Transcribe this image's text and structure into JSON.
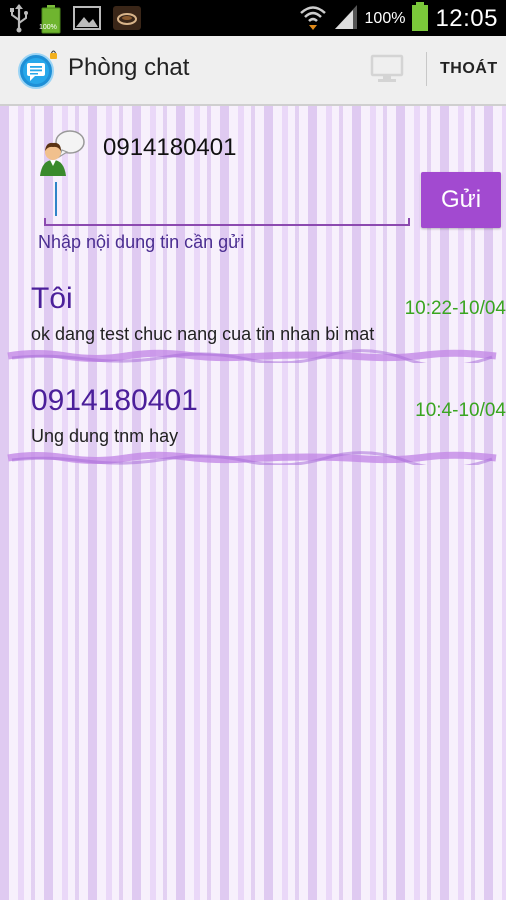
{
  "status_bar": {
    "battery_small_label": "100%",
    "battery_percent": "100%",
    "time": "12:05"
  },
  "action_bar": {
    "title": "Phòng chat",
    "exit_label": "THOÁT"
  },
  "compose": {
    "recipient": "0914180401",
    "input_value": "",
    "hint": "Nhập nội dung tin cần gửi",
    "send_label": "Gửi"
  },
  "messages": [
    {
      "sender": "Tôi",
      "time": "10:22-10/04",
      "text": "ok dang test chuc nang cua tin nhan bi mat"
    },
    {
      "sender": "0914180401",
      "time": "10:4-10/04",
      "text": "Ung dung tnm hay"
    }
  ],
  "colors": {
    "accent": "#a24ad0",
    "sender": "#4b1f9a",
    "time": "#39a520",
    "hint": "#4b2e91"
  },
  "icons": {
    "usb": "usb-icon",
    "battery_status": "battery-status-icon",
    "gallery": "gallery-icon",
    "coffee": "coffee-icon",
    "wifi": "wifi-icon",
    "signal": "signal-icon",
    "battery": "battery-icon",
    "app": "chat-app-icon",
    "monitor": "monitor-icon",
    "contact": "contact-avatar-icon"
  }
}
